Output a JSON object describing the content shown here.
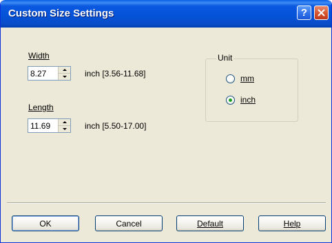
{
  "window": {
    "title": "Custom Size Settings",
    "help_glyph": "?",
    "close_icon": "close-icon"
  },
  "width": {
    "label": "Width",
    "value": "8.27",
    "range": "inch [3.56-11.68]"
  },
  "length": {
    "label": "Length",
    "value": "11.69",
    "range": "inch [5.50-17.00]"
  },
  "unit": {
    "group_label": "Unit",
    "options": [
      {
        "label": "mm",
        "selected": false
      },
      {
        "label": "inch",
        "selected": true
      }
    ]
  },
  "buttons": {
    "ok": "OK",
    "cancel": "Cancel",
    "default": "Default",
    "help": "Help"
  },
  "colors": {
    "titlebar": "#0452d6",
    "close": "#d6542c",
    "dialog_bg": "#ece9d8",
    "radio_dot": "#21a121"
  }
}
